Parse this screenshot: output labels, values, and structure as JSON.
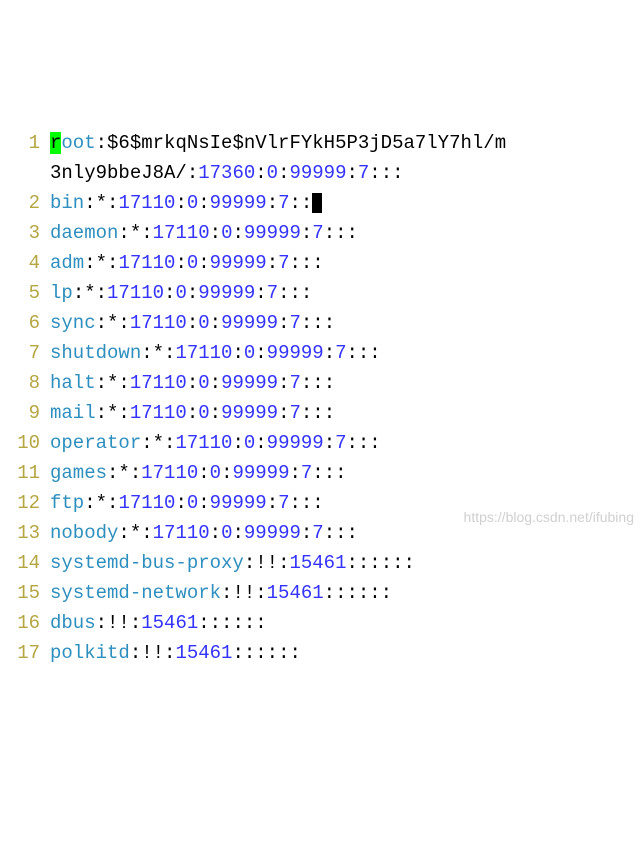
{
  "watermark": "https://blog.csdn.net/ifubing",
  "lines": [
    {
      "n": 1,
      "user": "root",
      "hl": "r",
      "rest_user": "oot",
      "sep1": ":",
      "hash": "$6$mrkqNsIe$nVlrFYkH5P3jD5a7lY7hl/m",
      "wrap": "3nly9bbeJ8A/",
      "sep2": ":",
      "v1": "17360",
      "sep3": ":",
      "v2": "0",
      "sep4": ":",
      "v3": "99999",
      "sep5": ":",
      "v4": "7",
      "tail": ":::"
    },
    {
      "n": 2,
      "user": "bin",
      "sep1": ":",
      "ast": "*",
      "sep2": ":",
      "v1": "17110",
      "sep3": ":",
      "v2": "0",
      "sep4": ":",
      "v3": "99999",
      "sep5": ":",
      "v4": "7",
      "tail": "::",
      "cursor": true
    },
    {
      "n": 3,
      "user": "daemon",
      "sep1": ":",
      "ast": "*",
      "sep2": ":",
      "v1": "17110",
      "sep3": ":",
      "v2": "0",
      "sep4": ":",
      "v3": "99999",
      "sep5": ":",
      "v4": "7",
      "tail": ":::"
    },
    {
      "n": 4,
      "user": "adm",
      "sep1": ":",
      "ast": "*",
      "sep2": ":",
      "v1": "17110",
      "sep3": ":",
      "v2": "0",
      "sep4": ":",
      "v3": "99999",
      "sep5": ":",
      "v4": "7",
      "tail": ":::"
    },
    {
      "n": 5,
      "user": "lp",
      "sep1": ":",
      "ast": "*",
      "sep2": ":",
      "v1": "17110",
      "sep3": ":",
      "v2": "0",
      "sep4": ":",
      "v3": "99999",
      "sep5": ":",
      "v4": "7",
      "tail": ":::"
    },
    {
      "n": 6,
      "user": "sync",
      "sep1": ":",
      "ast": "*",
      "sep2": ":",
      "v1": "17110",
      "sep3": ":",
      "v2": "0",
      "sep4": ":",
      "v3": "99999",
      "sep5": ":",
      "v4": "7",
      "tail": ":::"
    },
    {
      "n": 7,
      "user": "shutdown",
      "sep1": ":",
      "ast": "*",
      "sep2": ":",
      "v1": "17110",
      "sep3": ":",
      "v2": "0",
      "sep4": ":",
      "v3": "99999",
      "sep5": ":",
      "v4": "7",
      "tail": ":::"
    },
    {
      "n": 8,
      "user": "halt",
      "sep1": ":",
      "ast": "*",
      "sep2": ":",
      "v1": "17110",
      "sep3": ":",
      "v2": "0",
      "sep4": ":",
      "v3": "99999",
      "sep5": ":",
      "v4": "7",
      "tail": ":::"
    },
    {
      "n": 9,
      "user": "mail",
      "sep1": ":",
      "ast": "*",
      "sep2": ":",
      "v1": "17110",
      "sep3": ":",
      "v2": "0",
      "sep4": ":",
      "v3": "99999",
      "sep5": ":",
      "v4": "7",
      "tail": ":::"
    },
    {
      "n": 10,
      "user": "operator",
      "sep1": ":",
      "ast": "*",
      "sep2": ":",
      "v1": "17110",
      "sep3": ":",
      "v2": "0",
      "sep4": ":",
      "v3": "99999",
      "sep5": ":",
      "v4": "7",
      "tail": ":::"
    },
    {
      "n": 11,
      "user": "games",
      "sep1": ":",
      "ast": "*",
      "sep2": ":",
      "v1": "17110",
      "sep3": ":",
      "v2": "0",
      "sep4": ":",
      "v3": "99999",
      "sep5": ":",
      "v4": "7",
      "tail": ":::"
    },
    {
      "n": 12,
      "user": "ftp",
      "sep1": ":",
      "ast": "*",
      "sep2": ":",
      "v1": "17110",
      "sep3": ":",
      "v2": "0",
      "sep4": ":",
      "v3": "99999",
      "sep5": ":",
      "v4": "7",
      "tail": ":::"
    },
    {
      "n": 13,
      "user": "nobody",
      "sep1": ":",
      "ast": "*",
      "sep2": ":",
      "v1": "17110",
      "sep3": ":",
      "v2": "0",
      "sep4": ":",
      "v3": "99999",
      "sep5": ":",
      "v4": "7",
      "tail": ":::"
    },
    {
      "n": 14,
      "user": "systemd-bus-proxy",
      "sep1": ":",
      "excl": "!!",
      "sep2": ":",
      "v1": "15461",
      "tail": "::::::"
    },
    {
      "n": 15,
      "user": "systemd-network",
      "sep1": ":",
      "excl": "!!",
      "sep2": ":",
      "v1": "15461",
      "tail": "::::::"
    },
    {
      "n": 16,
      "user": "dbus",
      "sep1": ":",
      "excl": "!!",
      "sep2": ":",
      "v1": "15461",
      "tail": "::::::"
    },
    {
      "n": 17,
      "user": "polkitd",
      "sep1": ":",
      "excl": "!!",
      "sep2": ":",
      "v1": "15461",
      "tail": "::::::",
      "partial": true
    }
  ]
}
